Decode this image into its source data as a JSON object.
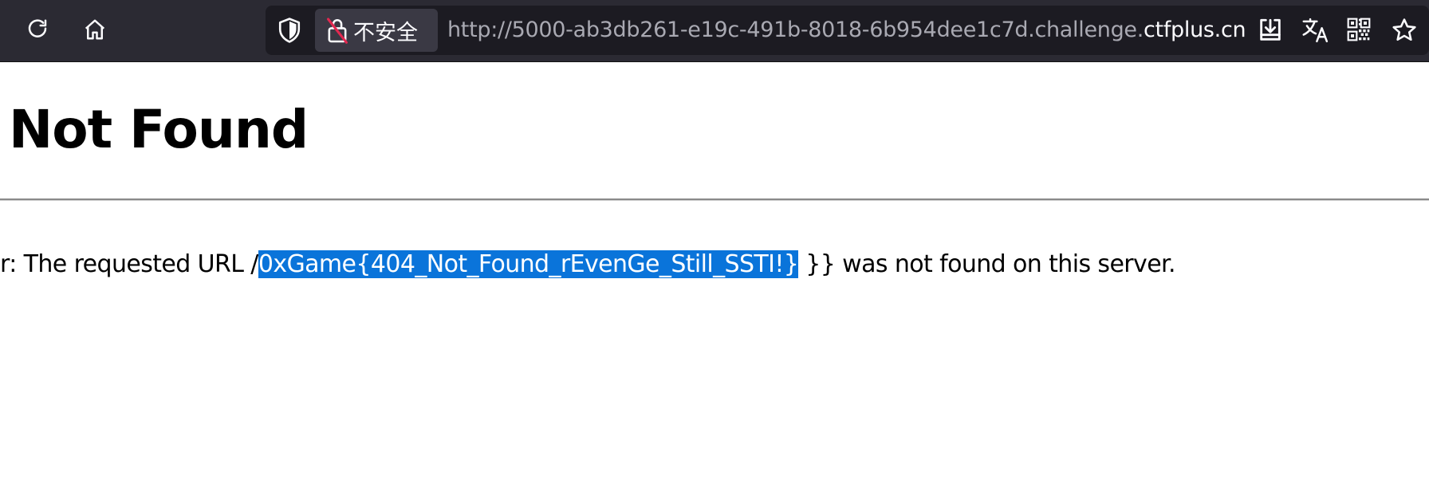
{
  "browser": {
    "security_label": "不安全",
    "url_prefix": "http://5000-ab3db261-e19c-491b-8018-6b954dee1c7d.challenge.",
    "url_host": "ctfplus.cn",
    "icons": [
      "reload-icon",
      "home-icon",
      "shield-icon",
      "insecure-lock-icon",
      "download-icon",
      "translate-icon",
      "qr-code-icon",
      "bookmark-star-icon"
    ]
  },
  "page": {
    "heading": "Not Found",
    "message_prefix": "r: The requested URL /",
    "message_selected": "0xGame{404_Not_Found_rEvenGe_Still_SSTI!}",
    "message_suffix": " }} was not found on this server."
  },
  "colors": {
    "toolbar_bg": "#2b2a33",
    "urlbar_bg": "#1c1b22",
    "selection": "#0a74da"
  }
}
